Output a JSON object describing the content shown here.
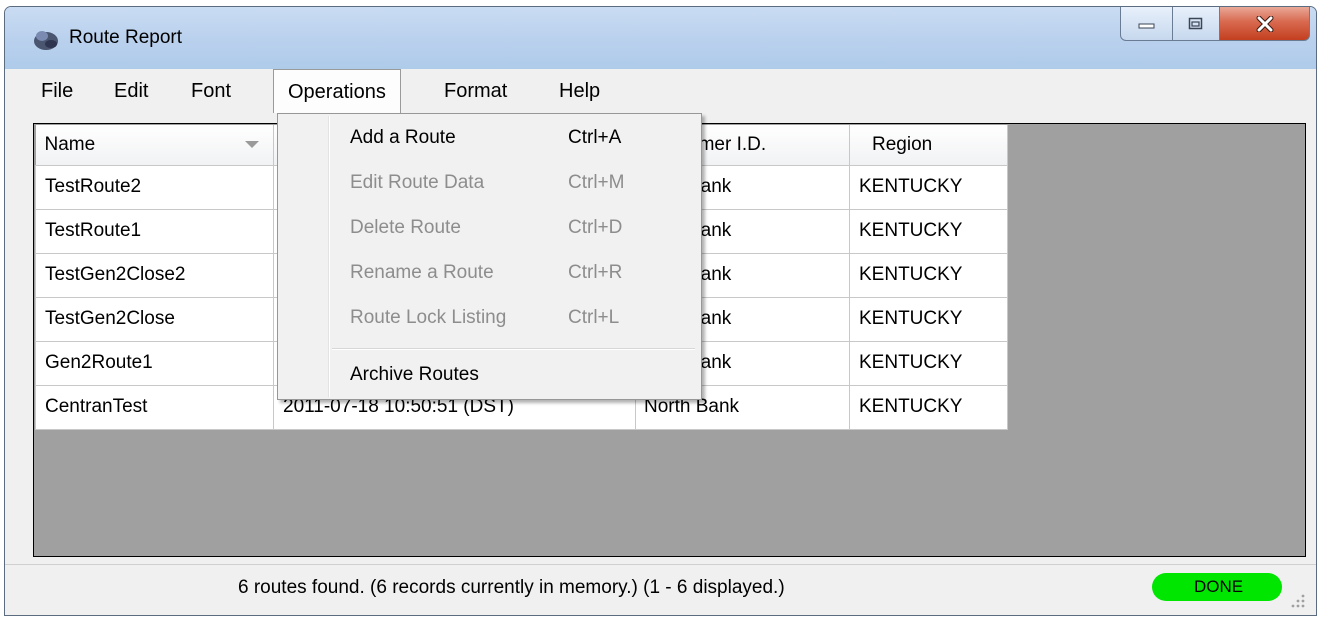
{
  "window": {
    "title": "Route Report"
  },
  "menubar": {
    "items": [
      {
        "label": "File"
      },
      {
        "label": "Edit"
      },
      {
        "label": "Font"
      },
      {
        "label": "Operations",
        "active": true
      },
      {
        "label": "Format"
      },
      {
        "label": "Help"
      }
    ]
  },
  "operations_menu": {
    "items": [
      {
        "label": "Add a Route",
        "shortcut": "Ctrl+A",
        "enabled": true
      },
      {
        "label": "Edit Route Data",
        "shortcut": "Ctrl+M",
        "enabled": false
      },
      {
        "label": "Delete Route",
        "shortcut": "Ctrl+D",
        "enabled": false
      },
      {
        "label": "Rename a Route",
        "shortcut": "Ctrl+R",
        "enabled": false
      },
      {
        "label": "Route Lock Listing",
        "shortcut": "Ctrl+L",
        "enabled": false
      },
      {
        "label": "Archive Routes",
        "shortcut": "",
        "enabled": true
      }
    ]
  },
  "grid": {
    "columns": [
      "Name",
      "",
      "omer I.D.",
      "Region"
    ],
    "rows": [
      {
        "name": "TestRoute2",
        "date": "",
        "customer": "Bank",
        "region": "KENTUCKY"
      },
      {
        "name": "TestRoute1",
        "date": "",
        "customer": "Bank",
        "region": "KENTUCKY"
      },
      {
        "name": "TestGen2Close2",
        "date": "",
        "customer": "Bank",
        "region": "KENTUCKY"
      },
      {
        "name": "TestGen2Close",
        "date": "",
        "customer": "Bank",
        "region": "KENTUCKY"
      },
      {
        "name": "Gen2Route1",
        "date": "",
        "customer": "Bank",
        "region": "KENTUCKY"
      },
      {
        "name": "CentranTest",
        "date": "2011-07-18 10:50:51 (DST)",
        "customer": "North Bank",
        "region": "KENTUCKY"
      }
    ]
  },
  "statusbar": {
    "text": "6 routes found.  (6 records currently in memory.)  (1 - 6 displayed.)",
    "badge": "DONE",
    "badge_color": "#00e600"
  },
  "colors": {
    "grid_background": "#a0a0a0",
    "close_button": "#c33f1f",
    "titlebar": "#bcd2ee"
  }
}
